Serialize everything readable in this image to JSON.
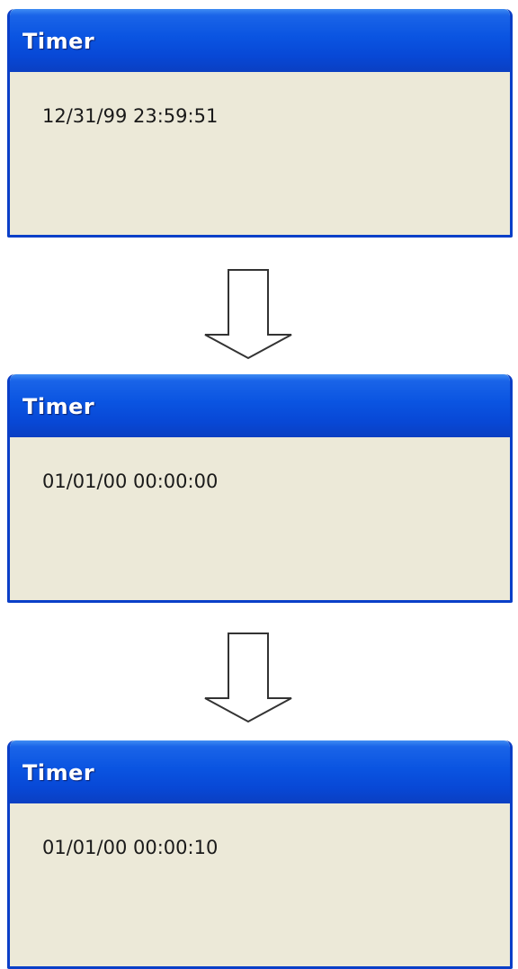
{
  "windows": [
    {
      "title": "Timer",
      "timestamp": "12/31/99 23:59:51"
    },
    {
      "title": "Timer",
      "timestamp": "01/01/00 00:00:00"
    },
    {
      "title": "Timer",
      "timestamp": "01/01/00 00:00:10"
    }
  ],
  "arrow_icon": "down-arrow-icon",
  "colors": {
    "titlebar": "#0a54e1",
    "frame": "#0a3fc8",
    "client": "#ece9d8"
  }
}
